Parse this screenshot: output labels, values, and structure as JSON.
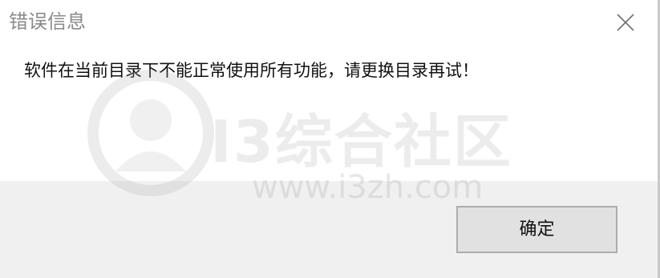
{
  "window": {
    "title": "错误信息"
  },
  "message": "软件在当前目录下不能正常使用所有功能，请更换目录再试！",
  "buttons": {
    "ok_label": "确定"
  },
  "icons": {
    "close": "close-icon"
  },
  "watermark": {
    "brand": "I3综合社区",
    "url": "www.i3zh.com"
  },
  "colors": {
    "footer_bg": "#f0f0f0",
    "button_bg": "#e1e1e1",
    "button_border": "#adadad",
    "title_text": "#8a8a8a"
  }
}
